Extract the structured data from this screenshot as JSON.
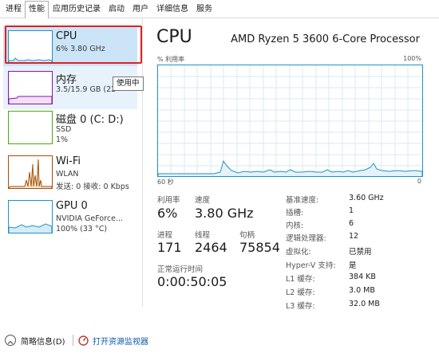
{
  "tabs": [
    {
      "label": "进程"
    },
    {
      "label": "性能"
    },
    {
      "label": "应用历史记录"
    },
    {
      "label": "启动"
    },
    {
      "label": "用户"
    },
    {
      "label": "详细信息"
    },
    {
      "label": "服务"
    }
  ],
  "devices": [
    {
      "name": "CPU",
      "sub1": "6% 3.80 GHz",
      "sub2": ""
    },
    {
      "name": "内存",
      "sub1": "3.5/15.9 GB (22",
      "sub2": ""
    },
    {
      "name": "磁盘 0 (C: D:)",
      "sub1": "SSD",
      "sub2": "1%"
    },
    {
      "name": "Wi-Fi",
      "sub1": "WLAN",
      "sub2": "发送: 0 接收: 0 Kbps"
    },
    {
      "name": "GPU 0",
      "sub1": "NVIDIA GeForce...",
      "sub2": "100% (33 °C)"
    }
  ],
  "tooltip": "使用中",
  "main": {
    "title": "CPU",
    "model": "AMD Ryzen 5 3600 6-Core Processor",
    "graph_top_left": "% 利用率",
    "graph_top_right": "100%",
    "graph_bottom_left": "60 秒",
    "graph_bottom_right": "0"
  },
  "stats": {
    "utilization_label": "利用率",
    "utilization": "6%",
    "speed_label": "速度",
    "speed": "3.80 GHz",
    "processes_label": "进程",
    "processes": "171",
    "threads_label": "线程",
    "threads": "2464",
    "handles_label": "句柄",
    "handles": "75854",
    "uptime_label": "正常运行时间",
    "uptime": "0:00:50:05"
  },
  "specs": [
    {
      "k": "基准速度:",
      "v": "3.60 GHz"
    },
    {
      "k": "插槽:",
      "v": "1"
    },
    {
      "k": "内核:",
      "v": "6"
    },
    {
      "k": "逻辑处理器:",
      "v": "12"
    },
    {
      "k": "虚拟化:",
      "v": "已禁用"
    },
    {
      "k": "Hyper-V 支持:",
      "v": "是"
    },
    {
      "k": "L1 缓存:",
      "v": "384 KB"
    },
    {
      "k": "L2 缓存:",
      "v": "3.0 MB"
    },
    {
      "k": "L3 缓存:",
      "v": "32.0 MB"
    }
  ],
  "footer": {
    "brief": "简略信息(D)",
    "monitor": "打开资源监视器"
  },
  "colors": {
    "cpu": "#1d93c6",
    "memory": "#8b12ae",
    "disk": "#4da60c",
    "wifi": "#a74f01",
    "gpu": "#1d93c6",
    "selection_outline": "#e02020"
  },
  "icons": [
    "chevron-up-icon",
    "resource-monitor-icon"
  ]
}
